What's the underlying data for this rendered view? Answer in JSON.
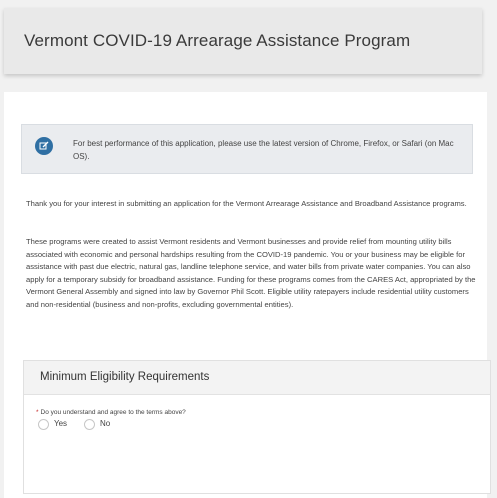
{
  "header": {
    "title": "Vermont COVID-19 Arrearage Assistance Program"
  },
  "notice": {
    "icon": "edit-icon",
    "text": "For best performance of this application, please use the latest version of Chrome, Firefox, or Safari (on Mac OS)."
  },
  "intro": {
    "paragraph1": "Thank you for your interest in submitting an application for the Vermont Arrearage Assistance and Broadband Assistance programs.",
    "paragraph2": "These programs were created to assist Vermont residents and Vermont businesses and provide relief from mounting utility bills associated with economic and personal hardships resulting from the COVID-19 pandemic. You or your business may be eligible for assistance with past due electric, natural gas, landline telephone service, and water bills from private water companies. You can also apply for a temporary subsidy for broadband assistance. Funding for these programs comes from the CARES Act, appropriated by the Vermont General Assembly and signed into law by Governor Phil Scott. Eligible utility ratepayers include residential utility customers and non-residential (business and non-profits, excluding governmental entities)."
  },
  "requirements": {
    "title": "Minimum Eligibility Requirements",
    "required_marker": "*",
    "question": "Do you understand and agree to the terms above?",
    "options": [
      "Yes",
      "No"
    ]
  },
  "colors": {
    "accent": "#2f6fa3",
    "required": "#c62828",
    "page_background": "#f1f1f1"
  }
}
